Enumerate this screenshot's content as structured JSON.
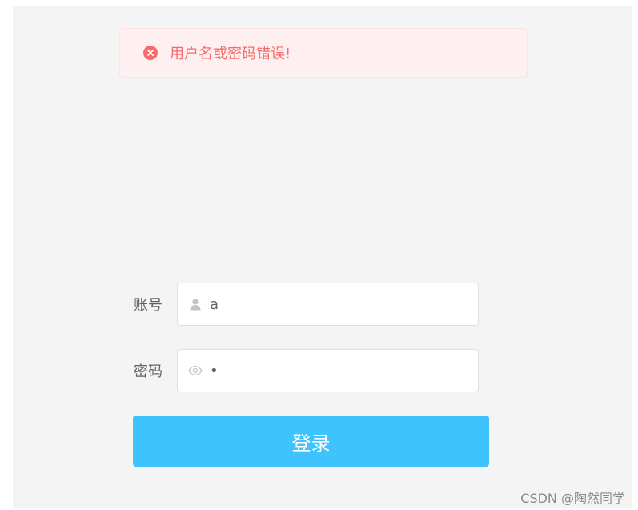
{
  "alert": {
    "message": "用户名或密码错误!",
    "icon": "error-circle-icon",
    "color": "#f56c6c"
  },
  "form": {
    "username": {
      "label": "账号",
      "value": "a",
      "icon": "user-icon"
    },
    "password": {
      "label": "密码",
      "value": "•",
      "icon": "eye-icon"
    },
    "submit_label": "登录",
    "submit_color": "#3ec3fd"
  },
  "watermark": "CSDN @陶然同学"
}
